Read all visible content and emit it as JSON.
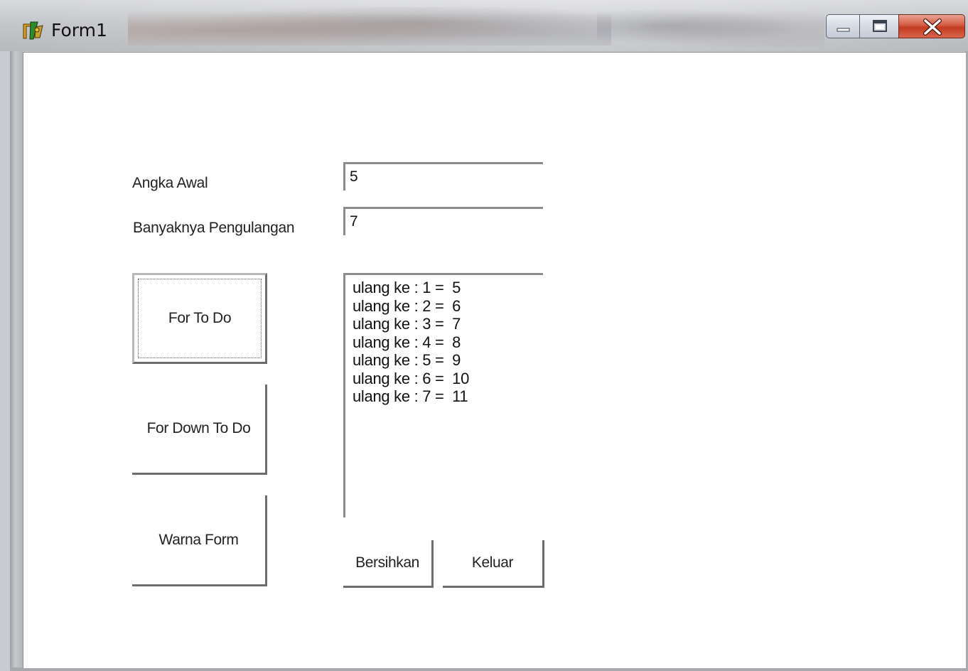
{
  "window": {
    "title": "Form1",
    "controls": {
      "minimize": "minimize-icon",
      "maximize": "maximize-icon",
      "close": "close-icon"
    }
  },
  "form": {
    "angka_awal_label": "Angka Awal",
    "angka_awal_value": "5",
    "pengulangan_label": "Banyaknya Pengulangan",
    "pengulangan_value": "7",
    "output_lines": [
      "ulang ke : 1 =  5",
      "ulang ke : 2 =  6",
      "ulang ke : 3 =  7",
      "ulang ke : 4 =  8",
      "ulang ke : 5 =  9",
      "ulang ke : 6 =  10",
      "ulang ke : 7 =  11"
    ],
    "buttons": {
      "for_to_do": "For To Do",
      "for_down_to_do": "For Down To Do",
      "warna_form": "Warna Form",
      "bersihkan": "Bersihkan",
      "keluar": "Keluar"
    }
  },
  "colors": {
    "close_button": "#c23c22",
    "client_background": "#ffffff"
  }
}
